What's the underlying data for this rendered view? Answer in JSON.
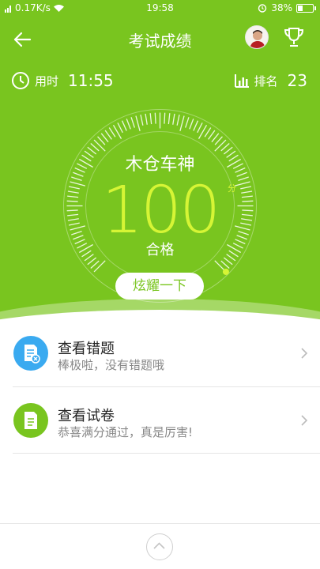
{
  "status": {
    "network": "0.17K/s",
    "time": "19:58",
    "battery": "38%",
    "battery_level": 0.38
  },
  "nav": {
    "title": "考试成绩"
  },
  "stats": {
    "time_label": "用时",
    "time_value": "11:55",
    "rank_label": "排名",
    "rank_value": "23"
  },
  "result": {
    "name": "木仓车神",
    "score": "100",
    "unit": "分",
    "verdict": "合格",
    "brag_button": "炫耀一下"
  },
  "menu": [
    {
      "title": "查看错题",
      "subtitle": "棒极啦，没有错题哦",
      "icon": "wrong-answers-icon",
      "color": "#3aaaf0"
    },
    {
      "title": "查看试卷",
      "subtitle": "恭喜满分通过，真是厉害!",
      "icon": "paper-icon",
      "color": "#79c51f"
    }
  ],
  "colors": {
    "primary": "#79c51f",
    "score": "#d6f535",
    "blue": "#3aaaf0"
  }
}
